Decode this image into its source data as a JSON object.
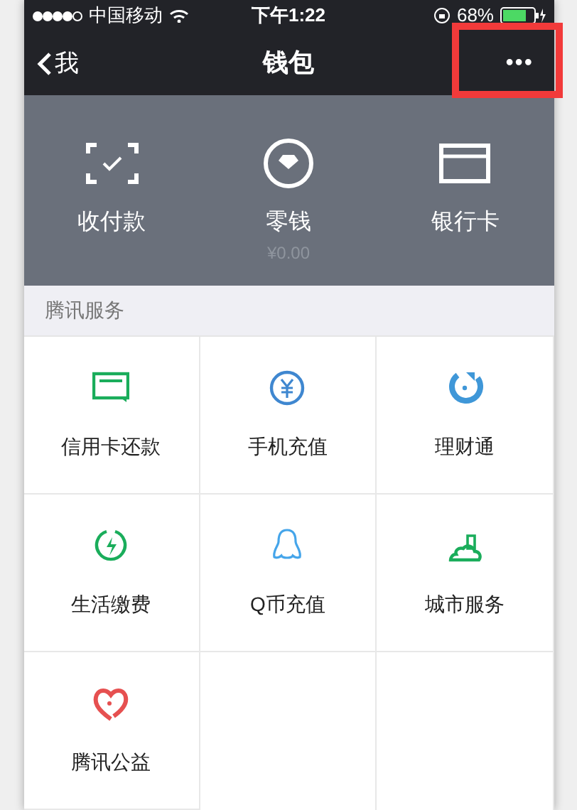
{
  "status_bar": {
    "carrier": "中国移动",
    "time": "下午1:22",
    "battery": "68%"
  },
  "nav": {
    "back": "我",
    "title": "钱包",
    "more": "•••"
  },
  "wallet_actions": [
    {
      "label": "收付款"
    },
    {
      "label": "零钱",
      "sub": "¥0.00"
    },
    {
      "label": "银行卡"
    }
  ],
  "section_title": "腾讯服务",
  "services": [
    {
      "label": "信用卡还款",
      "color": "#1aad5b"
    },
    {
      "label": "手机充值",
      "color": "#3f87d0"
    },
    {
      "label": "理财通",
      "color": "#3f97d8"
    },
    {
      "label": "生活缴费",
      "color": "#1aad5b"
    },
    {
      "label": "Q币充值",
      "color": "#45a5ea"
    },
    {
      "label": "城市服务",
      "color": "#1aad5b"
    },
    {
      "label": "腾讯公益",
      "color": "#e65050"
    }
  ]
}
